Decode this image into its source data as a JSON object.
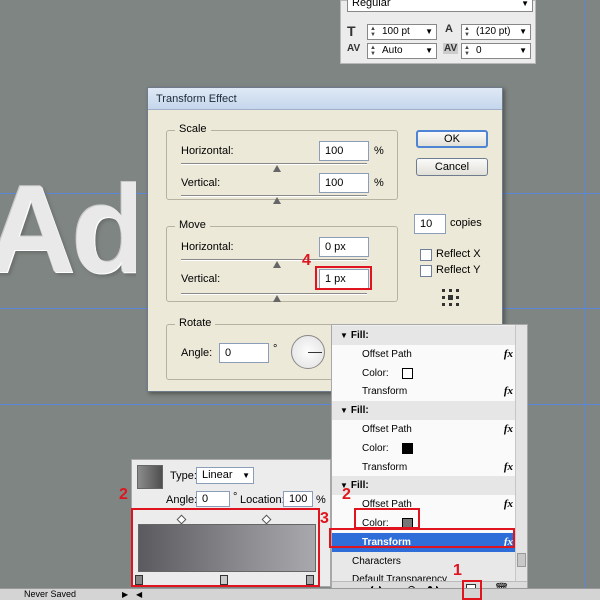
{
  "character_panel": {
    "font_style": "Regular",
    "font_size": "100 pt",
    "leading": "(120 pt)",
    "kerning": "Auto",
    "tracking": "0",
    "icon_size": "T",
    "icon_leading": "A",
    "icon_kerning": "AV",
    "icon_tracking": "AV"
  },
  "canvas": {
    "text": "Ad"
  },
  "dialog": {
    "title": "Transform Effect",
    "scale": {
      "label": "Scale",
      "horizontal_label": "Horizontal:",
      "horizontal_value": "100",
      "vertical_label": "Vertical:",
      "vertical_value": "100",
      "unit": "%"
    },
    "move": {
      "label": "Move",
      "horizontal_label": "Horizontal:",
      "horizontal_value": "0 px",
      "vertical_label": "Vertical:",
      "vertical_value": "1 px"
    },
    "rotate": {
      "label": "Rotate",
      "angle_label": "Angle:",
      "angle_value": "0",
      "degree": "°"
    },
    "ok_label": "OK",
    "cancel_label": "Cancel",
    "copies_value": "10",
    "copies_label": "copies",
    "reflect_x": "Reflect X",
    "reflect_y": "Reflect Y"
  },
  "appearance": {
    "rows": [
      {
        "kind": "header",
        "label": "Fill:"
      },
      {
        "kind": "item",
        "label": "Offset Path",
        "fx": "fx"
      },
      {
        "kind": "color",
        "label": "Color:",
        "swatch": "#ffffff"
      },
      {
        "kind": "item",
        "label": "Transform",
        "fx": "fx"
      },
      {
        "kind": "header",
        "label": "Fill:"
      },
      {
        "kind": "item",
        "label": "Offset Path",
        "fx": "fx"
      },
      {
        "kind": "color",
        "label": "Color:",
        "swatch": "#000000"
      },
      {
        "kind": "item",
        "label": "Transform",
        "fx": "fx"
      },
      {
        "kind": "header",
        "label": "Fill:"
      },
      {
        "kind": "item",
        "label": "Offset Path",
        "fx": "fx"
      },
      {
        "kind": "color",
        "label": "Color:",
        "swatch": "#777777"
      },
      {
        "kind": "selected",
        "label": "Transform",
        "fx": "fx"
      },
      {
        "kind": "plain",
        "label": "Characters"
      },
      {
        "kind": "plain",
        "label": "Default Transparency"
      }
    ]
  },
  "gradient": {
    "type_label": "Type:",
    "type_value": "Linear",
    "angle_label": "Angle:",
    "angle_value": "0",
    "degree": "°",
    "location_label": "Location:",
    "location_value": "100",
    "percent": "%"
  },
  "status": {
    "doc_state": "Never Saved"
  },
  "steps": {
    "one": "1",
    "two_a": "2",
    "two_b": "2",
    "three": "3",
    "four": "4"
  },
  "colors": {
    "highlight": "#e0141e",
    "selection": "#2f6ed8",
    "guide": "#5b86d8"
  }
}
